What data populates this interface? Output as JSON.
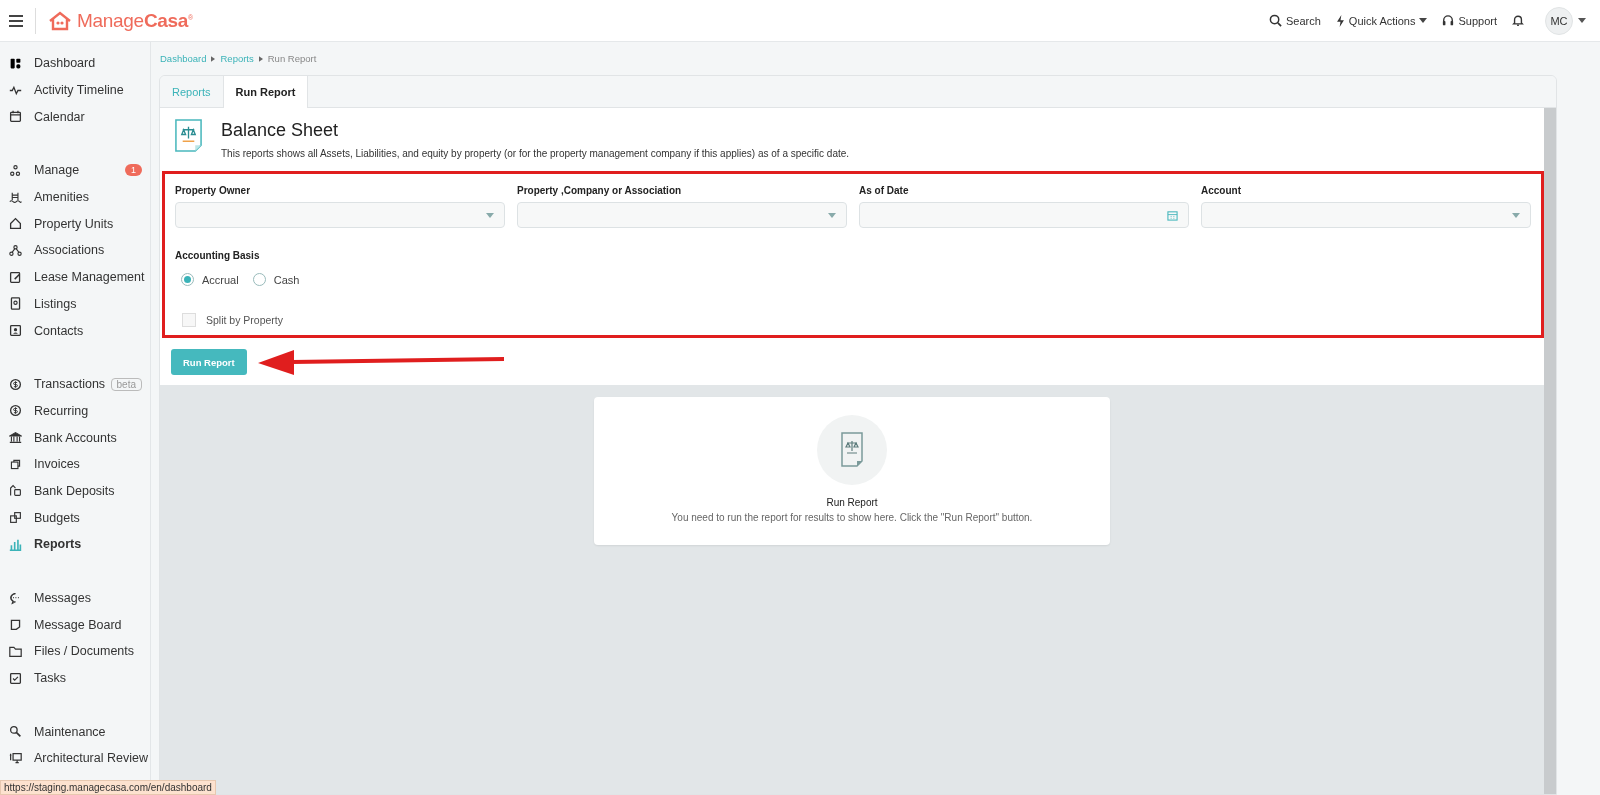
{
  "header": {
    "logo": "Manage**Casa**$^{®}$",
    "actions": [
      {
        "kind": "search",
        "label": "Search"
      },
      {
        "kind": "quick",
        "label": "Quick Actions"
      },
      {
        "kind": "support",
        "label": "Support"
      },
      {
        "kind": "bell"
      }
    ],
    "avatar": "MC"
  },
  "sidebar": {
    "groups": [
      {
        "items": [
          {
            "label": "Dashboard",
            "selected": false
          },
          {
            "label": "Activity Timeline",
            "selected": false
          },
          {
            "label": "Calendar",
            "selected": false
          }
        ]
      },
      {
        "items": [
          {
            "label": "Manage",
            "selected": false,
            "badge": "1"
          },
          {
            "label": "Amenities",
            "selected": false
          },
          {
            "label": "Property Units",
            "selected": false
          },
          {
            "label": "Associations",
            "selected": false
          },
          {
            "label": "Lease Management",
            "selected": false
          },
          {
            "label": "Listings",
            "selected": false
          },
          {
            "label": "Contacts",
            "selected": false
          }
        ]
      },
      {
        "items": [
          {
            "label": "Transactions",
            "selected": false,
            "tag": "beta"
          },
          {
            "label": "Recurring",
            "selected": false
          },
          {
            "label": "Bank Accounts",
            "selected": false
          },
          {
            "label": "Invoices",
            "selected": false
          },
          {
            "label": "Bank Deposits",
            "selected": false
          },
          {
            "label": "Budgets",
            "selected": false
          },
          {
            "label": "Reports",
            "selected": true
          }
        ]
      },
      {
        "items": [
          {
            "label": "Messages",
            "selected": false
          },
          {
            "label": "Message Board",
            "selected": false
          },
          {
            "label": "Files / Documents",
            "selected": false
          },
          {
            "label": "Tasks",
            "selected": false
          }
        ]
      },
      {
        "items": [
          {
            "label": "Maintenance",
            "selected": false
          },
          {
            "label": "Architectural Review",
            "selected": false
          }
        ]
      }
    ]
  },
  "breadcrumb": [
    "Dashboard",
    "Reports",
    "Run Report"
  ],
  "tabs": [
    {
      "label": "Reports",
      "selected": false
    },
    {
      "label": "Run Report",
      "selected": true
    }
  ],
  "report": {
    "title": "Balance Sheet",
    "description": "This reports shows all Assets, Liabilities, and equity by property (or for the property management company if this applies) as of a specific date."
  },
  "form": {
    "fields": [
      {
        "label": "Property Owner",
        "kind": "select"
      },
      {
        "label": "Property ,Company or Association",
        "kind": "select"
      },
      {
        "label": "As of Date",
        "kind": "date"
      },
      {
        "label": "Account",
        "kind": "select"
      }
    ],
    "basis": {
      "label": "Accounting Basis",
      "options": [
        {
          "label": "Accrual",
          "selected": true
        },
        {
          "label": "Cash",
          "selected": false
        }
      ]
    },
    "split": {
      "label": "Split by Property",
      "checked": false
    }
  },
  "run_button": "Run Report",
  "empty_state": {
    "title": "Run Report",
    "message": "You need to run the report for results to show here. Click the \"Run Report\" button."
  },
  "status_url": "https://staging.managecasa.com/en/dashboard"
}
